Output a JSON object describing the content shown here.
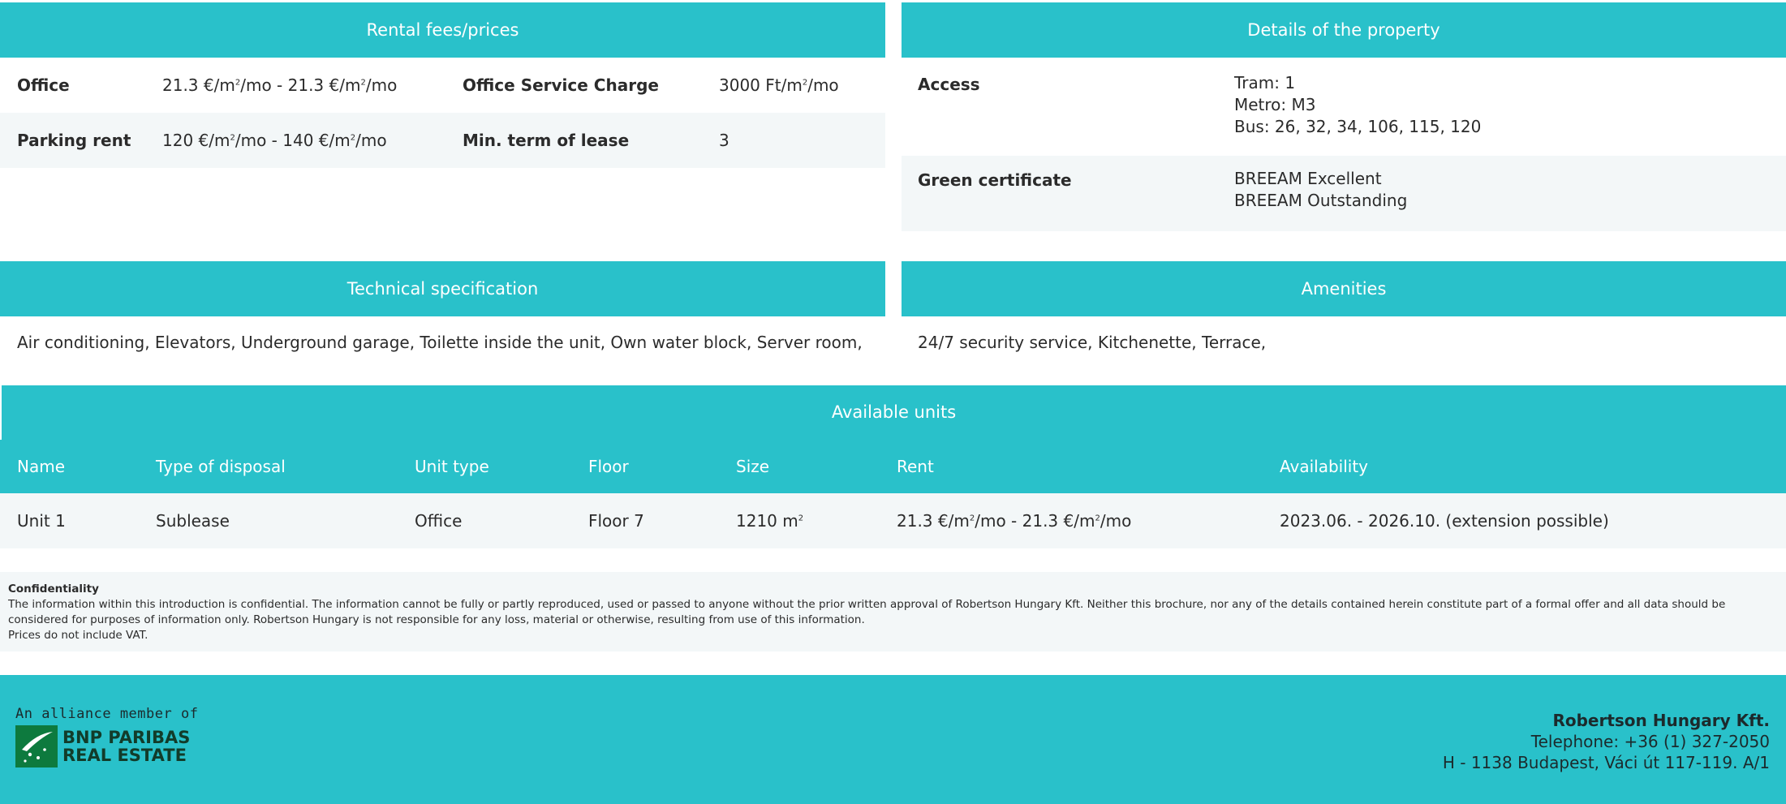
{
  "rental": {
    "title": "Rental fees/prices",
    "office_label": "Office",
    "office_from": "21.3 €/m",
    "office_to": "21.3 €/m",
    "per_month": "/mo",
    "range_sep": " - ",
    "service_label": "Office Service Charge",
    "service_value": "3000 Ft/m",
    "parking_label": "Parking rent",
    "parking_from": "120 €/m",
    "parking_to": "140 €/m",
    "min_term_label": "Min. term of lease",
    "min_term_value": "3",
    "sup": "2"
  },
  "details": {
    "title": "Details of the property",
    "access_label": "Access",
    "access_lines": [
      "Tram: 1",
      "Metro: M3",
      "Bus: 26, 32, 34, 106, 115, 120"
    ],
    "green_label": "Green certificate",
    "green_lines": [
      "BREEAM Excellent",
      "BREEAM Outstanding"
    ]
  },
  "technical": {
    "title": "Technical specification",
    "text": "Air conditioning, Elevators, Underground garage, Toilette inside the unit, Own water block, Server room,"
  },
  "amenities": {
    "title": "Amenities",
    "text": "24/7 security service, Kitchenette, Terrace,"
  },
  "units": {
    "title": "Available units",
    "columns": [
      "Name",
      "Type of disposal",
      "Unit type",
      "Floor",
      "Size",
      "Rent",
      "Availability"
    ],
    "rows": [
      {
        "name": "Unit 1",
        "disposal": "Sublease",
        "unit_type": "Office",
        "floor": "Floor 7",
        "size": "1210 m",
        "rent_from": "21.3 €/m",
        "rent_to": "21.3 €/m",
        "availability": "2023.06. - 2026.10. (extension possible)"
      }
    ]
  },
  "confidentiality": {
    "title": "Confidentiality",
    "text": "The information within this introduction is confidential. The information cannot be fully or partly reproduced, used or passed to anyone without the prior written approval of Robertson Hungary Kft. Neither this brochure, nor any of the details contained herein constitute part of a formal offer and all data should be considered for purposes of information only. Robertson Hungary is not responsible for any loss, material or otherwise, resulting from use of this information.",
    "vat": "Prices do not include VAT."
  },
  "footer": {
    "alliance": "An alliance member of",
    "logo_line1": "BNP PARIBAS",
    "logo_line2": "REAL ESTATE",
    "company": "Robertson Hungary Kft.",
    "telephone": "Telephone: +36 (1) 327-2050",
    "address": "H - 1138 Budapest, Váci út 117-119. A/1"
  },
  "colors": {
    "accent": "#29c1ca",
    "row_alt": "#f3f7f8",
    "logo_green": "#0d7a3e"
  }
}
